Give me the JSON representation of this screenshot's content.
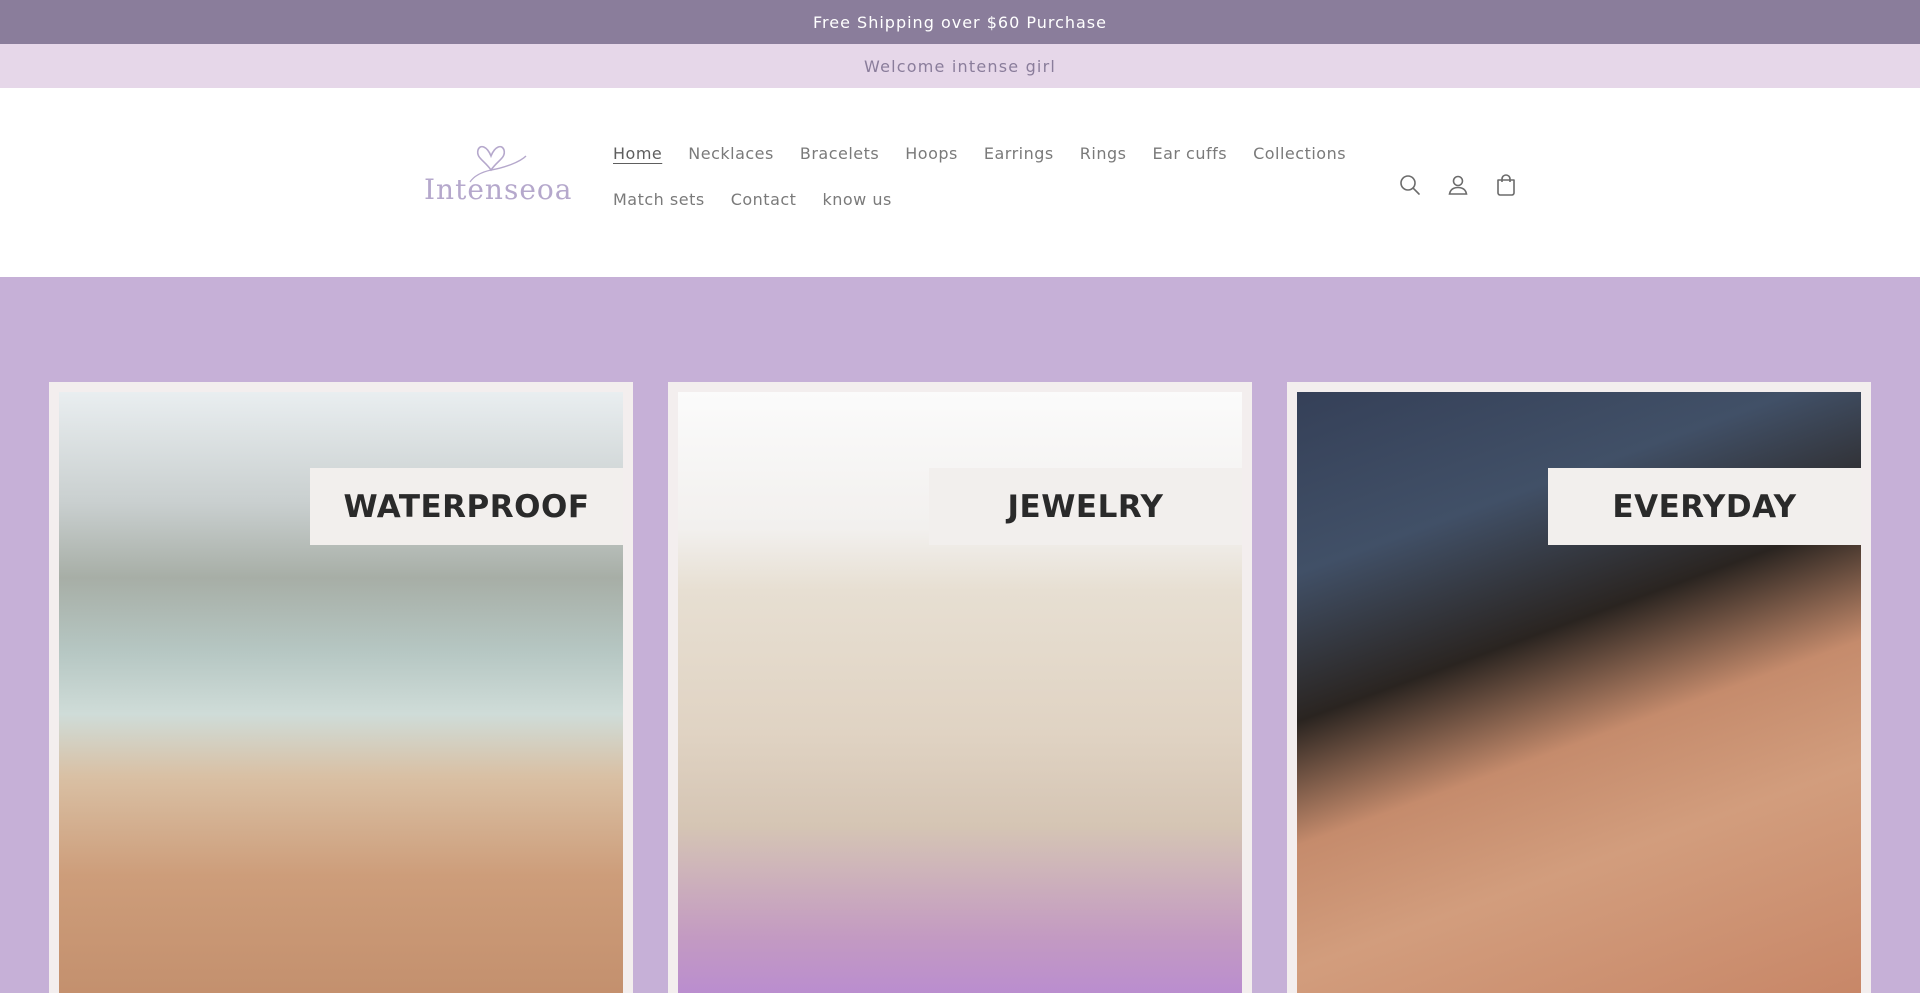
{
  "announcement": {
    "primary": "Free Shipping over $60 Purchase",
    "secondary": "Welcome intense girl"
  },
  "header": {
    "logo_text": "Intenseoa",
    "nav": {
      "row1": [
        "Home",
        "Necklaces",
        "Bracelets",
        "Hoops",
        "Earrings",
        "Rings",
        "Ear cuffs",
        "Collections"
      ],
      "row2": [
        "Match sets",
        "Contact",
        "know us"
      ]
    },
    "icons": [
      "search-icon",
      "account-icon",
      "cart-icon"
    ]
  },
  "hero": {
    "cards": [
      {
        "label": "WATERPROOF"
      },
      {
        "label": "JEWELRY"
      },
      {
        "label": "EVERYDAY"
      }
    ]
  },
  "colors": {
    "bar_primary": "#8a7d9b",
    "bar_secondary": "#e6d7e9",
    "hero_bg": "#c6b0d7",
    "logo": "#b5a8cc"
  }
}
